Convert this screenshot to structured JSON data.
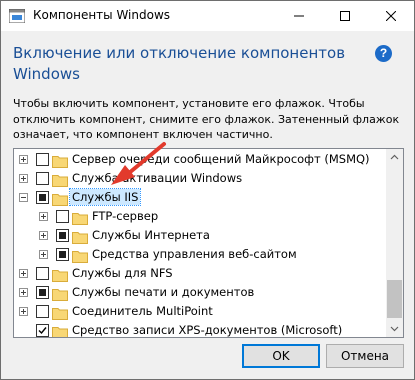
{
  "window": {
    "title": "Компоненты Windows",
    "icon": "windows-features-icon"
  },
  "header": {
    "title": "Включение или отключение компонентов Windows",
    "help_icon": "help-icon"
  },
  "description": "Чтобы включить компонент, установите его флажок. Чтобы отключить компонент, снимите его флажок. Затененный флажок означает, что компонент включен частично.",
  "tree": {
    "items": [
      {
        "label": "Сервер очереди сообщений Майкрософт (MSMQ)",
        "state": "unchecked",
        "expander": "plus",
        "level": 0
      },
      {
        "label": "Служба активации Windows",
        "state": "unchecked",
        "expander": "plus",
        "level": 0
      },
      {
        "label": "Службы IIS",
        "state": "partial",
        "expander": "minus",
        "level": 0,
        "selected": true
      },
      {
        "label": "FTP-сервер",
        "state": "unchecked",
        "expander": "plus",
        "level": 1
      },
      {
        "label": "Службы Интернета",
        "state": "partial",
        "expander": "plus",
        "level": 1
      },
      {
        "label": "Средства управления веб-сайтом",
        "state": "partial",
        "expander": "plus",
        "level": 1
      },
      {
        "label": "Службы для NFS",
        "state": "unchecked",
        "expander": "plus",
        "level": 0
      },
      {
        "label": "Службы печати и документов",
        "state": "partial",
        "expander": "plus",
        "level": 0
      },
      {
        "label": "Соединитель MultiPoint",
        "state": "unchecked",
        "expander": "plus",
        "level": 0
      },
      {
        "label": "Средство записи XPS-документов (Microsoft)",
        "state": "checked",
        "expander": "none",
        "level": 0
      }
    ]
  },
  "buttons": {
    "ok": "OK",
    "cancel": "Отмена"
  },
  "colors": {
    "header": "#1a4f96",
    "folder": "#f8d775",
    "selection": "#cce8ff",
    "annotation_arrow": "#e23a2c"
  }
}
